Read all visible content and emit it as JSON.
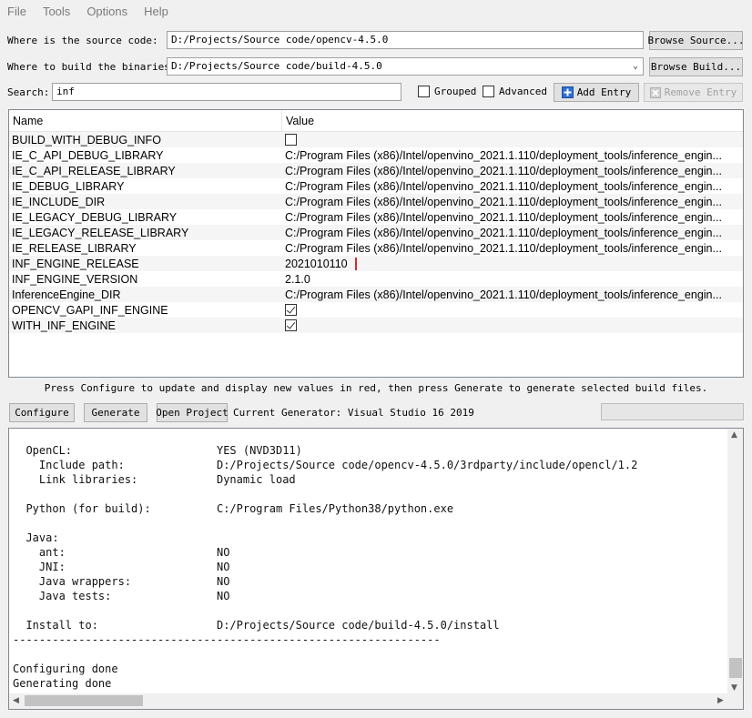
{
  "menu": [
    "File",
    "Tools",
    "Options",
    "Help"
  ],
  "source": {
    "label": "Where is the source code:",
    "value": "D:/Projects/Source code/opencv-4.5.0",
    "browse_label": "Browse Source..."
  },
  "build": {
    "label": "Where to build the binaries:",
    "value": "D:/Projects/Source code/build-4.5.0",
    "browse_label": "Browse Build..."
  },
  "search": {
    "label": "Search:",
    "value": "inf"
  },
  "options": {
    "grouped_label": "Grouped",
    "advanced_label": "Advanced"
  },
  "buttons": {
    "add_entry": "Add Entry",
    "remove_entry": "Remove Entry",
    "configure": "Configure",
    "generate": "Generate",
    "open_project": "Open Project"
  },
  "table": {
    "headers": {
      "name": "Name",
      "value": "Value"
    },
    "rows": [
      {
        "name": "BUILD_WITH_DEBUG_INFO",
        "value": "",
        "checkbox": false
      },
      {
        "name": "IE_C_API_DEBUG_LIBRARY",
        "value": "C:/Program Files (x86)/Intel/openvino_2021.1.110/deployment_tools/inference_engin..."
      },
      {
        "name": "IE_C_API_RELEASE_LIBRARY",
        "value": "C:/Program Files (x86)/Intel/openvino_2021.1.110/deployment_tools/inference_engin..."
      },
      {
        "name": "IE_DEBUG_LIBRARY",
        "value": "C:/Program Files (x86)/Intel/openvino_2021.1.110/deployment_tools/inference_engin..."
      },
      {
        "name": "IE_INCLUDE_DIR",
        "value": "C:/Program Files (x86)/Intel/openvino_2021.1.110/deployment_tools/inference_engin..."
      },
      {
        "name": "IE_LEGACY_DEBUG_LIBRARY",
        "value": "C:/Program Files (x86)/Intel/openvino_2021.1.110/deployment_tools/inference_engin..."
      },
      {
        "name": "IE_LEGACY_RELEASE_LIBRARY",
        "value": "C:/Program Files (x86)/Intel/openvino_2021.1.110/deployment_tools/inference_engin..."
      },
      {
        "name": "IE_RELEASE_LIBRARY",
        "value": "C:/Program Files (x86)/Intel/openvino_2021.1.110/deployment_tools/inference_engin..."
      },
      {
        "name": "INF_ENGINE_RELEASE",
        "value": "2021010110",
        "highlight": true
      },
      {
        "name": "INF_ENGINE_VERSION",
        "value": "2.1.0"
      },
      {
        "name": "InferenceEngine_DIR",
        "value": "C:/Program Files (x86)/Intel/openvino_2021.1.110/deployment_tools/inference_engin..."
      },
      {
        "name": "OPENCV_GAPI_INF_ENGINE",
        "value": "",
        "checkbox": true
      },
      {
        "name": "WITH_INF_ENGINE",
        "value": "",
        "checkbox": true
      }
    ]
  },
  "hint": "Press Configure to update and display new values in red, then press Generate to generate selected build files.",
  "generator": "Current Generator: Visual Studio 16 2019",
  "output_lines": [
    "  OpenCL:                      YES (NVD3D11)",
    "    Include path:              D:/Projects/Source code/opencv-4.5.0/3rdparty/include/opencl/1.2",
    "    Link libraries:            Dynamic load",
    "",
    "  Python (for build):          C:/Program Files/Python38/python.exe",
    "",
    "  Java:",
    "    ant:                       NO",
    "    JNI:                       NO",
    "    Java wrappers:             NO",
    "    Java tests:                NO",
    "",
    "  Install to:                  D:/Projects/Source code/build-4.5.0/install",
    "-----------------------------------------------------------------",
    "",
    "Configuring done",
    "Generating done"
  ],
  "colors": {
    "highlight_border": "#e0262d"
  }
}
